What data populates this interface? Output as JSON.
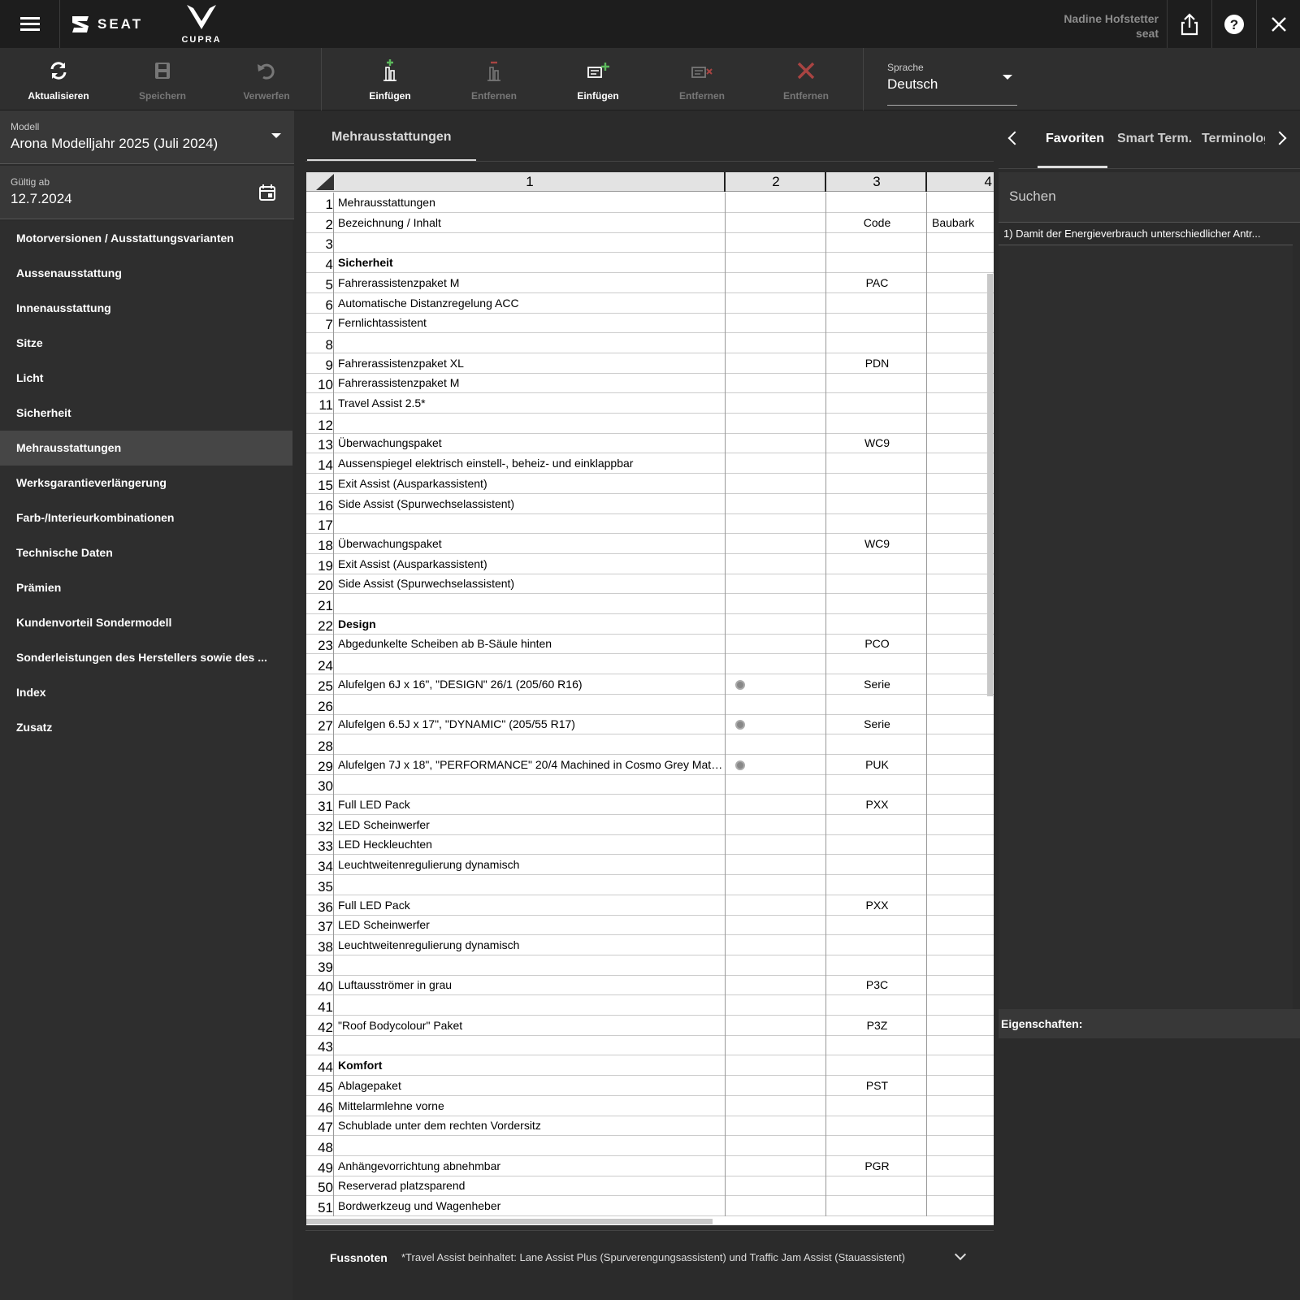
{
  "header": {
    "brand_seat": "SEAT",
    "brand_cupra": "CUPRA",
    "user_name": "Nadine Hofstetter",
    "user_org": "seat"
  },
  "toolbar": {
    "buttons": [
      {
        "label": "Aktualisieren",
        "icon": "refresh-icon",
        "enabled": true
      },
      {
        "label": "Speichern",
        "icon": "save-icon",
        "enabled": false
      },
      {
        "label": "Verwerfen",
        "icon": "undo-icon",
        "enabled": false
      },
      {
        "label": "Einfügen",
        "icon": "insert-column-icon",
        "enabled": true
      },
      {
        "label": "Entfernen",
        "icon": "remove-column-icon",
        "enabled": false
      },
      {
        "label": "Einfügen",
        "icon": "insert-row-icon",
        "enabled": true
      },
      {
        "label": "Entfernen",
        "icon": "remove-row-icon",
        "enabled": false
      },
      {
        "label": "Entfernen",
        "icon": "delete-icon",
        "enabled": false
      }
    ],
    "language_caption": "Sprache",
    "language_value": "Deutsch"
  },
  "left": {
    "model_caption": "Modell",
    "model_value": "Arona Modelljahr 2025 (Juli 2024)",
    "valid_caption": "Gültig ab",
    "valid_value": "12.7.2024",
    "nav": [
      "Motorversionen / Ausstattungsvarianten",
      "Aussenausstattung",
      "Innenausstattung",
      "Sitze",
      "Licht",
      "Sicherheit",
      "Mehrausstattungen",
      "Werksgarantieverlängerung",
      "Farb-/Interieurkombinationen",
      "Technische Daten",
      "Prämien",
      "Kundenvorteil Sondermodell",
      "Sonderleistungen des Herstellers sowie des ...",
      "Index",
      "Zusatz"
    ],
    "selected_index": 6
  },
  "center": {
    "tab": "Mehrausstattungen",
    "columns": [
      "1",
      "2",
      "3",
      "4"
    ],
    "rows": [
      {
        "n": "1",
        "c1": "Mehrausstattungen",
        "c3": "",
        "c4": ""
      },
      {
        "n": "2",
        "c1": "Bezeichnung / Inhalt",
        "c3": "Code",
        "c4": "Baubark"
      },
      {
        "n": "3",
        "c1": "",
        "c3": "",
        "c4": ""
      },
      {
        "n": "4",
        "c1": "Sicherheit",
        "c3": "",
        "c4": "",
        "bold": true
      },
      {
        "n": "5",
        "c1": "Fahrerassistenzpaket M",
        "c3": "PAC",
        "c4": ""
      },
      {
        "n": "6",
        "c1": "Automatische Distanzregelung ACC",
        "c3": "",
        "c4": ""
      },
      {
        "n": "7",
        "c1": "Fernlichtassistent",
        "c3": "",
        "c4": ""
      },
      {
        "n": "8",
        "c1": "",
        "c3": "",
        "c4": ""
      },
      {
        "n": "9",
        "c1": "Fahrerassistenzpaket XL",
        "c3": "PDN",
        "c4": ""
      },
      {
        "n": "10",
        "c1": "Fahrerassistenzpaket M",
        "c3": "",
        "c4": ""
      },
      {
        "n": "11",
        "c1": "Travel Assist 2.5*",
        "c3": "",
        "c4": ""
      },
      {
        "n": "12",
        "c1": "",
        "c3": "",
        "c4": ""
      },
      {
        "n": "13",
        "c1": "Überwachungspaket",
        "c3": "WC9",
        "c4": ""
      },
      {
        "n": "14",
        "c1": "Aussenspiegel elektrisch einstell-, beheiz- und einklappbar",
        "c3": "",
        "c4": ""
      },
      {
        "n": "15",
        "c1": "Exit Assist (Ausparkassistent)",
        "c3": "",
        "c4": ""
      },
      {
        "n": "16",
        "c1": "Side Assist (Spurwechselassistent)",
        "c3": "",
        "c4": ""
      },
      {
        "n": "17",
        "c1": "",
        "c3": "",
        "c4": ""
      },
      {
        "n": "18",
        "c1": "Überwachungspaket",
        "c3": "WC9",
        "c4": ""
      },
      {
        "n": "19",
        "c1": "Exit Assist (Ausparkassistent)",
        "c3": "",
        "c4": ""
      },
      {
        "n": "20",
        "c1": "Side Assist (Spurwechselassistent)",
        "c3": "",
        "c4": ""
      },
      {
        "n": "21",
        "c1": "",
        "c3": "",
        "c4": ""
      },
      {
        "n": "22",
        "c1": "Design",
        "c3": "",
        "c4": "",
        "bold": true
      },
      {
        "n": "23",
        "c1": "Abgedunkelte Scheiben ab B-Säule hinten",
        "c3": "PCO",
        "c4": ""
      },
      {
        "n": "24",
        "c1": "",
        "c3": "",
        "c4": ""
      },
      {
        "n": "25",
        "c1": "Alufelgen 6J x 16\", \"DESIGN\" 26/1 (205/60 R16)",
        "c3": "Serie",
        "c4": "",
        "img": true
      },
      {
        "n": "26",
        "c1": "",
        "c3": "",
        "c4": ""
      },
      {
        "n": "27",
        "c1": "Alufelgen 6.5J x 17\", \"DYNAMIC\" (205/55 R17)",
        "c3": "Serie",
        "c4": "",
        "img": true
      },
      {
        "n": "28",
        "c1": "",
        "c3": "",
        "c4": ""
      },
      {
        "n": "29",
        "c1": "Alufelgen 7J x 18\", \"PERFORMANCE\" 20/4 Machined in Cosmo Grey Matt ...",
        "c3": "PUK",
        "c4": "",
        "img": true
      },
      {
        "n": "30",
        "c1": "",
        "c3": "",
        "c4": ""
      },
      {
        "n": "31",
        "c1": "Full LED Pack",
        "c3": "PXX",
        "c4": ""
      },
      {
        "n": "32",
        "c1": "LED Scheinwerfer",
        "c3": "",
        "c4": ""
      },
      {
        "n": "33",
        "c1": "LED Heckleuchten",
        "c3": "",
        "c4": ""
      },
      {
        "n": "34",
        "c1": "Leuchtweitenregulierung dynamisch",
        "c3": "",
        "c4": ""
      },
      {
        "n": "35",
        "c1": "",
        "c3": "",
        "c4": ""
      },
      {
        "n": "36",
        "c1": "Full LED Pack",
        "c3": "PXX",
        "c4": ""
      },
      {
        "n": "37",
        "c1": "LED Scheinwerfer",
        "c3": "",
        "c4": ""
      },
      {
        "n": "38",
        "c1": "Leuchtweitenregulierung dynamisch",
        "c3": "",
        "c4": ""
      },
      {
        "n": "39",
        "c1": "",
        "c3": "",
        "c4": ""
      },
      {
        "n": "40",
        "c1": "Luftausströmer in grau",
        "c3": "P3C",
        "c4": ""
      },
      {
        "n": "41",
        "c1": "",
        "c3": "",
        "c4": ""
      },
      {
        "n": "42",
        "c1": "\"Roof Bodycolour\" Paket",
        "c3": "P3Z",
        "c4": ""
      },
      {
        "n": "43",
        "c1": "",
        "c3": "",
        "c4": ""
      },
      {
        "n": "44",
        "c1": "Komfort",
        "c3": "",
        "c4": "",
        "bold": true
      },
      {
        "n": "45",
        "c1": "Ablagepaket",
        "c3": "PST",
        "c4": ""
      },
      {
        "n": "46",
        "c1": "Mittelarmlehne vorne",
        "c3": "",
        "c4": ""
      },
      {
        "n": "47",
        "c1": "Schublade unter dem rechten Vordersitz",
        "c3": "",
        "c4": ""
      },
      {
        "n": "48",
        "c1": "",
        "c3": "",
        "c4": ""
      },
      {
        "n": "49",
        "c1": "Anhängevorrichtung abnehmbar",
        "c3": "PGR",
        "c4": ""
      },
      {
        "n": "50",
        "c1": "Reserverad platzsparend",
        "c3": "",
        "c4": ""
      },
      {
        "n": "51",
        "c1": "Bordwerkzeug und Wagenheber",
        "c3": "",
        "c4": ""
      }
    ],
    "footnote_caption": "Fussnoten",
    "footnote_text": "*Travel Assist beinhaltet: Lane Assist Plus (Spurverengungsassistent) und Traffic Jam Assist (Stauassistent)"
  },
  "right": {
    "tabs": [
      "Favoriten",
      "Smart Term.",
      "Terminolog"
    ],
    "selected_tab": 0,
    "search_placeholder": "Suchen",
    "footnote_item": "1) Damit der Energieverbrauch unterschiedlicher Antr...",
    "properties_label": "Eigenschaften:"
  },
  "colors": {
    "topbar": "#1d1d1d",
    "toolbar": "#2f2f2f",
    "panel": "#2b2b2b",
    "selected_nav": "#464646",
    "accent_green": "#5cb85c",
    "accent_red": "#d9534f"
  }
}
